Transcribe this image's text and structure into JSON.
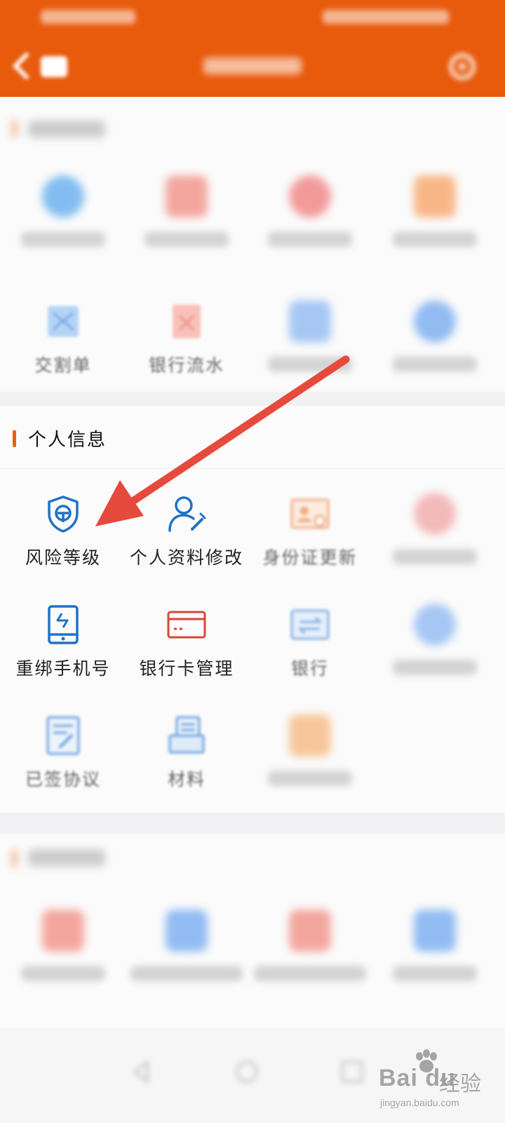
{
  "header": {
    "status_left": "",
    "status_right": "",
    "title": "",
    "back_icon": "back-arrow-icon",
    "settings_icon": "gear-icon"
  },
  "sections": {
    "trade_query": {
      "title": "",
      "items": [
        {
          "label": "",
          "color": "#5aa8ee"
        },
        {
          "label": "",
          "color": "#f08a80"
        },
        {
          "label": "",
          "color": "#f07a7a"
        },
        {
          "label": "",
          "color": "#f6a060"
        },
        {
          "label": "交割单",
          "color": "#7fb6ef",
          "icon": "document-icon"
        },
        {
          "label": "银行流水",
          "color": "#f39287",
          "icon": "bank-statement-icon"
        },
        {
          "label": "",
          "color": "#8ab6f2"
        },
        {
          "label": "",
          "color": "#6ea6ef"
        }
      ]
    },
    "personal_info": {
      "title": "个人信息",
      "items": [
        {
          "label": "风险等级",
          "icon": "shield-icon",
          "color": "#1f72c7"
        },
        {
          "label": "个人资料修改",
          "icon": "user-edit-icon",
          "color": "#1f72c7"
        },
        {
          "label": "身份证更新",
          "icon": "id-card-icon",
          "color": "#f0a070"
        },
        {
          "label": "",
          "icon": "badge-icon",
          "color": "#f0a0a0"
        },
        {
          "label": "重绑手机号",
          "icon": "phone-icon",
          "color": "#1f72c7"
        },
        {
          "label": "银行卡管理",
          "icon": "bank-card-icon",
          "color": "#d8473a"
        },
        {
          "label": "银行",
          "icon": "card-switch-icon",
          "color": "#6a9fe0"
        },
        {
          "label": "",
          "icon": "building-icon",
          "color": "#8ab6f2"
        },
        {
          "label": "已签协议",
          "icon": "agreement-icon",
          "color": "#4d8fd8"
        },
        {
          "label": "材料",
          "icon": "materials-icon",
          "color": "#4d8fd8"
        },
        {
          "label": "",
          "icon": "edit-icon",
          "color": "#f0a070"
        }
      ]
    },
    "account_mgmt": {
      "title": "",
      "items": [
        {
          "label": "",
          "color": "#f08a80"
        },
        {
          "label": "",
          "color": "#6ea6ef"
        },
        {
          "label": "",
          "color": "#f08a80"
        },
        {
          "label": "",
          "color": "#6ea6ef"
        }
      ]
    }
  },
  "annotation": {
    "arrow_color": "#e64a3c"
  },
  "watermark": {
    "brand": "Bai du",
    "suffix": "经验",
    "url": "jingyan.baidu.com"
  },
  "colors": {
    "accent": "#e85a0c",
    "section_bar": "#e5630f"
  }
}
